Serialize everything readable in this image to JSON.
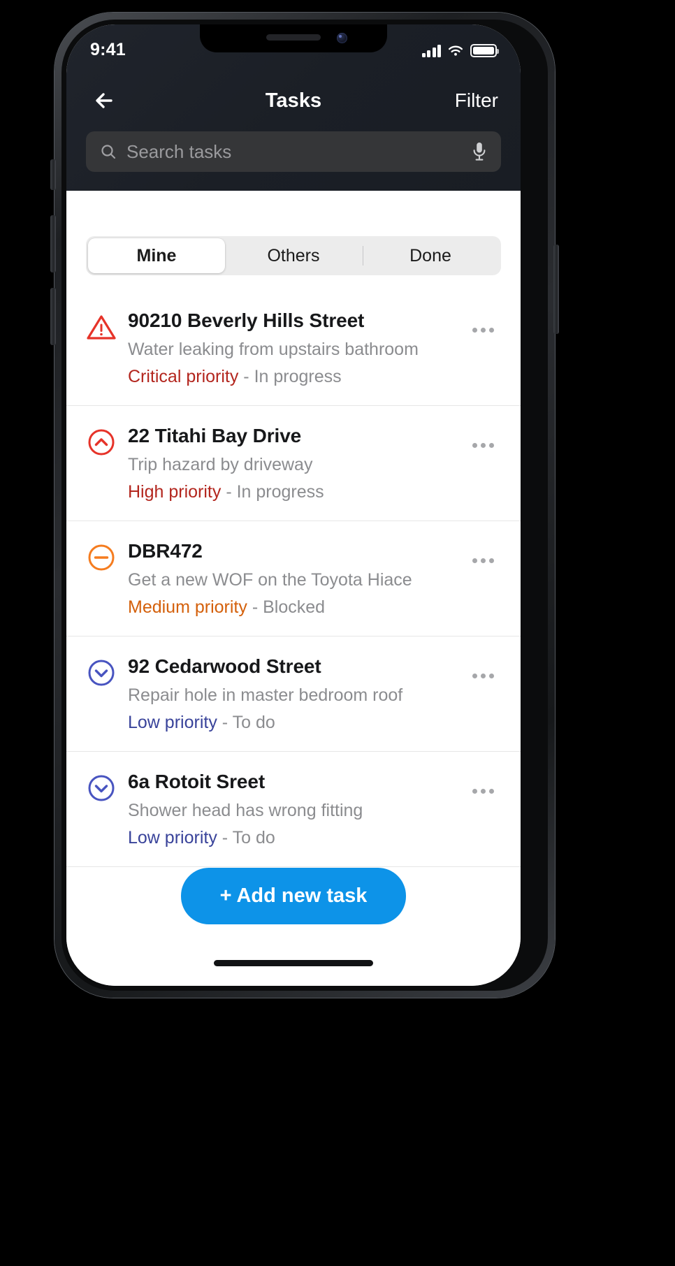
{
  "status_bar": {
    "time": "9:41",
    "signal_icon": "cellular-signal-icon",
    "wifi_icon": "wifi-icon",
    "battery_icon": "battery-full-icon"
  },
  "nav": {
    "back_icon": "back-arrow-icon",
    "title": "Tasks",
    "filter_label": "Filter"
  },
  "search": {
    "placeholder": "Search tasks",
    "value": "",
    "search_icon": "search-icon",
    "mic_icon": "microphone-icon"
  },
  "tabs": [
    {
      "label": "Mine",
      "selected": true
    },
    {
      "label": "Others",
      "selected": false
    },
    {
      "label": "Done",
      "selected": false
    }
  ],
  "colors": {
    "critical": "#d32f2f",
    "critical_text": "#b3261e",
    "high": "#b3261e",
    "high_icon": "#e63329",
    "medium": "#d4600b",
    "medium_icon": "#f57c1f",
    "low": "#39439a",
    "low_icon": "#4854c0",
    "accent": "#0d93e8",
    "muted": "#8b8c8f",
    "header_bg": "#1b1f26"
  },
  "tasks": [
    {
      "title": "90210 Beverly Hills Street",
      "description": "Water leaking from upstairs bathroom",
      "priority": "Critical priority",
      "separator": " - ",
      "status": "In progress",
      "icon": "warning-triangle-icon",
      "priority_color": "#b3261e",
      "more_icon": "more-options-icon"
    },
    {
      "title": "22 Titahi Bay Drive",
      "description": "Trip hazard by driveway",
      "priority": "High priority",
      "separator": " - ",
      "status": "In progress",
      "icon": "chevron-up-circle-icon",
      "priority_color": "#b3261e",
      "more_icon": "more-options-icon"
    },
    {
      "title": "DBR472",
      "description": "Get a new WOF on the Toyota Hiace",
      "priority": "Medium priority",
      "separator": " - ",
      "status": "Blocked",
      "icon": "minus-circle-icon",
      "priority_color": "#d4600b",
      "more_icon": "more-options-icon"
    },
    {
      "title": "92 Cedarwood Street",
      "description": "Repair hole in master bedroom roof",
      "priority": "Low priority",
      "separator": " - ",
      "status": "To do",
      "icon": "chevron-down-circle-icon",
      "priority_color": "#39439a",
      "more_icon": "more-options-icon"
    },
    {
      "title": "6a Rotoit Sreet",
      "description": "Shower head has wrong fitting",
      "priority": "Low priority",
      "separator": " - ",
      "status": "To do",
      "icon": "chevron-down-circle-icon",
      "priority_color": "#39439a",
      "more_icon": "more-options-icon"
    }
  ],
  "add_button": {
    "label": "+ Add new task"
  }
}
